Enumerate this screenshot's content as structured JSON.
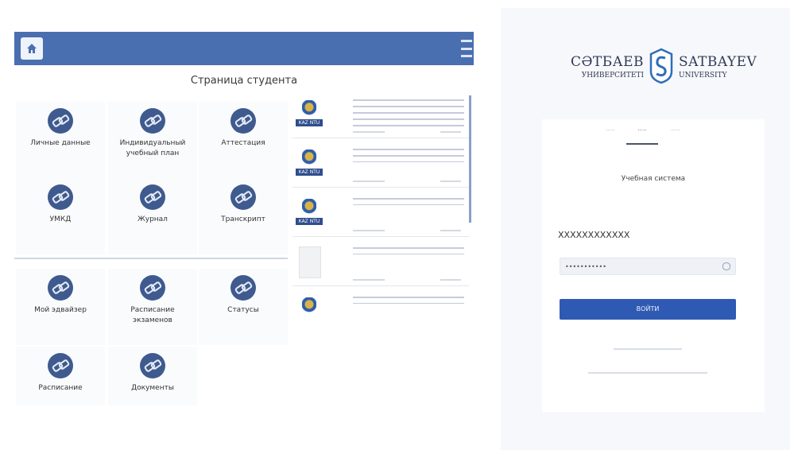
{
  "portal": {
    "page_title": "Страница студента",
    "tiles": [
      {
        "label": "Личные данные",
        "icon": "link-icon"
      },
      {
        "label": "Индивидуальный учебный план",
        "icon": "link-icon"
      },
      {
        "label": "Аттестация",
        "icon": "link-icon"
      },
      {
        "label": "УМКД",
        "icon": "link-icon"
      },
      {
        "label": "Журнал",
        "icon": "link-icon"
      },
      {
        "label": "Транскрипт",
        "icon": "link-icon"
      },
      {
        "label": "Мой эдвайзер",
        "icon": "link-icon"
      },
      {
        "label": "Расписание экзаменов",
        "icon": "link-icon"
      },
      {
        "label": "Статусы",
        "icon": "link-icon"
      },
      {
        "label": "Расписание",
        "icon": "link-icon"
      },
      {
        "label": "Документы",
        "icon": "link-icon"
      }
    ],
    "news_logo_text": "KAZ NTU"
  },
  "login": {
    "brand_kz": "СӘТБАЕВ",
    "brand_kz_sub": "УНИВЕРСИТЕТІ",
    "brand_en": "SATBAYEV",
    "brand_en_sub": "UNIVERSITY",
    "system_name": "Учебная система",
    "login_value": "XXXXXXXXXXXX",
    "submit_label": "ВОЙТИ",
    "accent_color": "#2f5ab3"
  }
}
